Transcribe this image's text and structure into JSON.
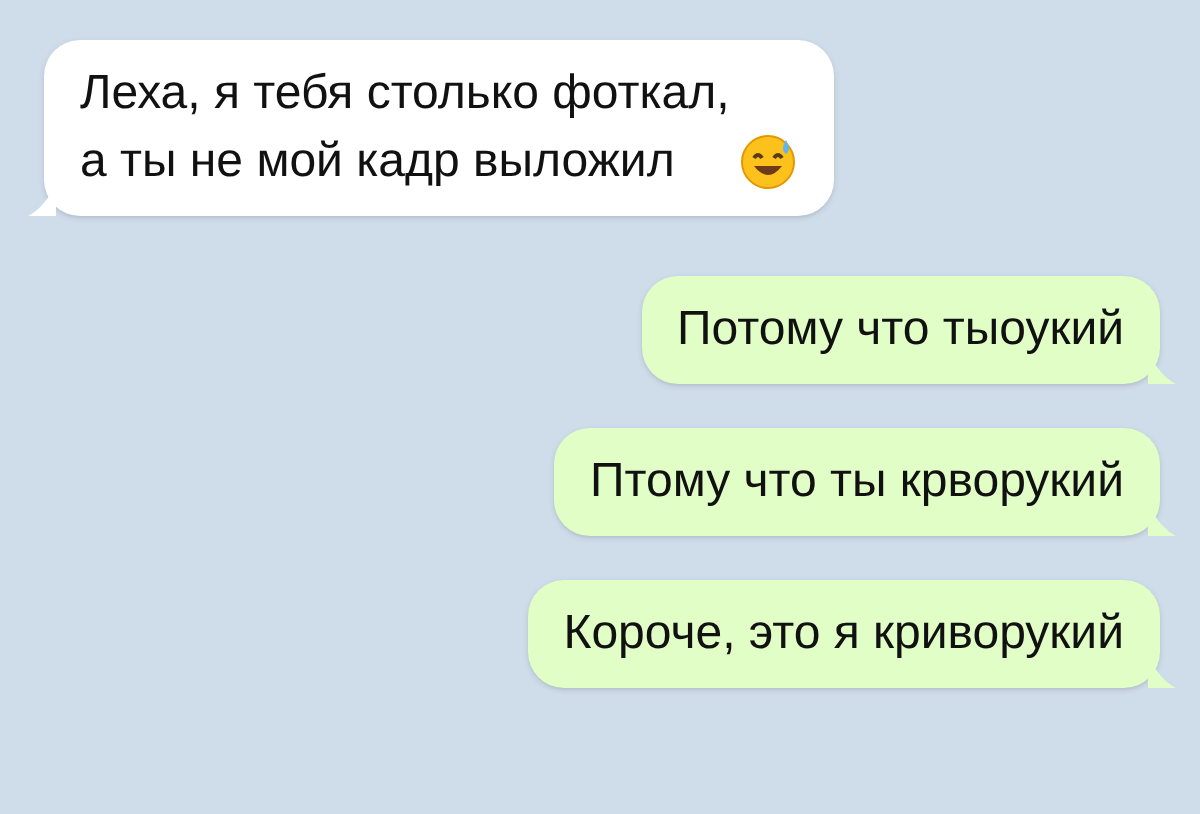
{
  "messages": [
    {
      "kind": "incoming",
      "text": "Леха, я тебя столько фоткал,\nа ты не мой кадр выложил",
      "emoji": true
    },
    {
      "kind": "outgoing",
      "text": "Потому что тыоукий",
      "emoji": false
    },
    {
      "kind": "outgoing",
      "text": "Птому что ты крворукий",
      "emoji": false
    },
    {
      "kind": "outgoing",
      "text": "Короче, это я криворукий",
      "emoji": false
    }
  ]
}
